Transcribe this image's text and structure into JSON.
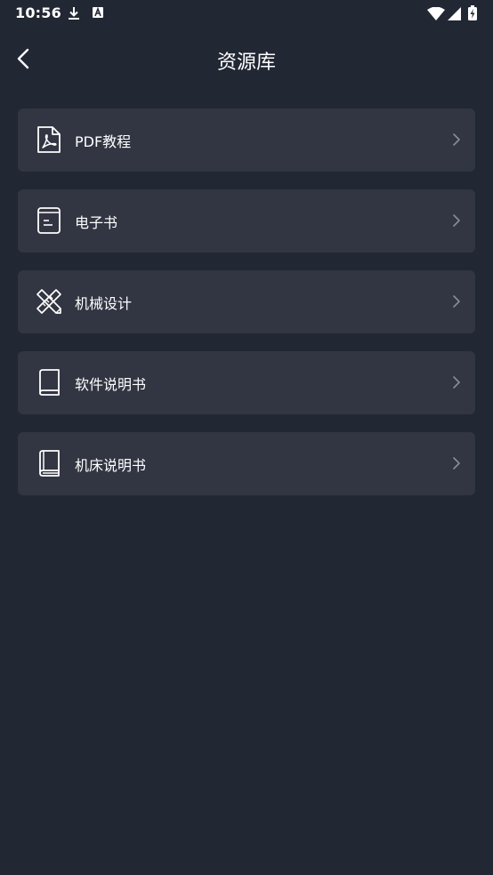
{
  "status_bar": {
    "time": "10:56",
    "icons": [
      "download-icon",
      "a-notification-icon",
      "wifi-icon",
      "signal-icon",
      "battery-charging-icon"
    ]
  },
  "header": {
    "title": "资源库",
    "back_icon": "chevron-left-icon"
  },
  "menu": {
    "items": [
      {
        "label": "PDF教程",
        "icon": "pdf-file-icon"
      },
      {
        "label": "电子书",
        "icon": "ebook-icon"
      },
      {
        "label": "机械设计",
        "icon": "pencil-ruler-icon"
      },
      {
        "label": "软件说明书",
        "icon": "book-icon"
      },
      {
        "label": "机床说明书",
        "icon": "manual-book-icon"
      }
    ]
  },
  "colors": {
    "background": "#222734",
    "card": "#323542",
    "text": "#ffffff",
    "chevron": "#8a8d98"
  }
}
